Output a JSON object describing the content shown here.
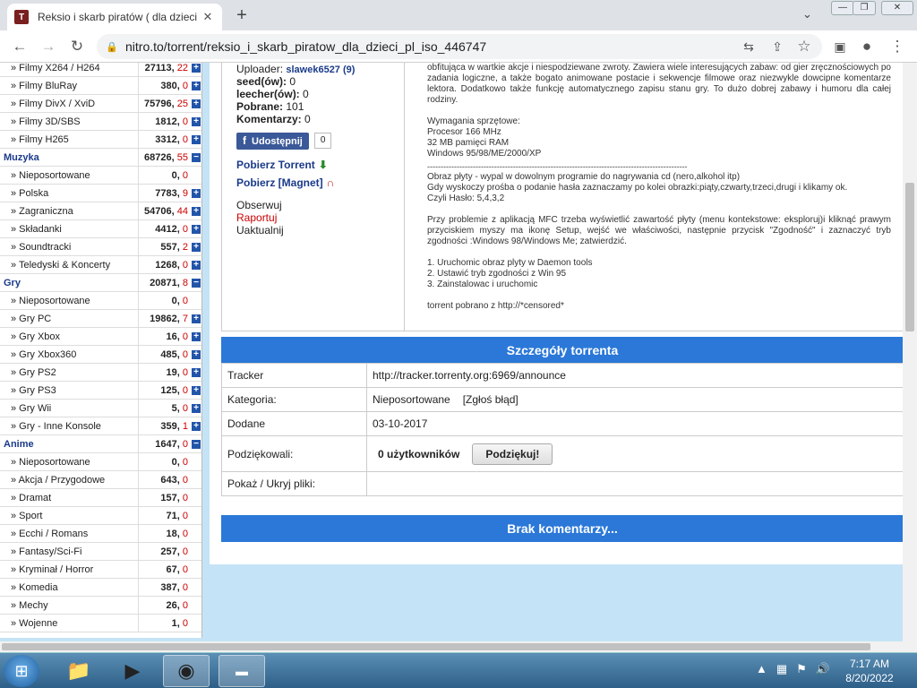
{
  "browser": {
    "tab_title": "Reksio i skarb piratów ( dla dzieci",
    "tab_favicon": "T",
    "url": "nitro.to/torrent/reksio_i_skarb_piratow_dla_dzieci_pl_iso_446747"
  },
  "sidebar": {
    "items": [
      {
        "label": "» Filmy X264 / H264",
        "count": "27113,",
        "new": "22",
        "sub": true,
        "toggle": "+"
      },
      {
        "label": "» Filmy BluRay",
        "count": "380,",
        "new": "0",
        "sub": true,
        "toggle": "+"
      },
      {
        "label": "» Filmy DivX / XviD",
        "count": "75796,",
        "new": "25",
        "sub": true,
        "toggle": "+"
      },
      {
        "label": "» Filmy 3D/SBS",
        "count": "1812,",
        "new": "0",
        "sub": true,
        "toggle": "+"
      },
      {
        "label": "» Filmy H265",
        "count": "3312,",
        "new": "0",
        "sub": true,
        "toggle": "+"
      },
      {
        "label": "Muzyka",
        "count": "68726,",
        "new": "55",
        "sub": false,
        "toggle": "−"
      },
      {
        "label": "» Nieposortowane",
        "count": "0,",
        "new": "0",
        "sub": true,
        "toggle": ""
      },
      {
        "label": "» Polska",
        "count": "7783,",
        "new": "9",
        "sub": true,
        "toggle": "+"
      },
      {
        "label": "» Zagraniczna",
        "count": "54706,",
        "new": "44",
        "sub": true,
        "toggle": "+"
      },
      {
        "label": "» Składanki",
        "count": "4412,",
        "new": "0",
        "sub": true,
        "toggle": "+"
      },
      {
        "label": "» Soundtracki",
        "count": "557,",
        "new": "2",
        "sub": true,
        "toggle": "+"
      },
      {
        "label": "» Teledyski & Koncerty",
        "count": "1268,",
        "new": "0",
        "sub": true,
        "toggle": "+"
      },
      {
        "label": "Gry",
        "count": "20871,",
        "new": "8",
        "sub": false,
        "toggle": "−"
      },
      {
        "label": "» Nieposortowane",
        "count": "0,",
        "new": "0",
        "sub": true,
        "toggle": ""
      },
      {
        "label": "» Gry PC",
        "count": "19862,",
        "new": "7",
        "sub": true,
        "toggle": "+"
      },
      {
        "label": "» Gry Xbox",
        "count": "16,",
        "new": "0",
        "sub": true,
        "toggle": "+"
      },
      {
        "label": "» Gry Xbox360",
        "count": "485,",
        "new": "0",
        "sub": true,
        "toggle": "+"
      },
      {
        "label": "» Gry PS2",
        "count": "19,",
        "new": "0",
        "sub": true,
        "toggle": "+"
      },
      {
        "label": "» Gry PS3",
        "count": "125,",
        "new": "0",
        "sub": true,
        "toggle": "+"
      },
      {
        "label": "» Gry Wii",
        "count": "5,",
        "new": "0",
        "sub": true,
        "toggle": "+"
      },
      {
        "label": "» Gry - Inne Konsole",
        "count": "359,",
        "new": "1",
        "sub": true,
        "toggle": "+"
      },
      {
        "label": "Anime",
        "count": "1647,",
        "new": "0",
        "sub": false,
        "toggle": "−"
      },
      {
        "label": "» Nieposortowane",
        "count": "0,",
        "new": "0",
        "sub": true,
        "toggle": ""
      },
      {
        "label": "» Akcja / Przygodowe",
        "count": "643,",
        "new": "0",
        "sub": true,
        "toggle": ""
      },
      {
        "label": "» Dramat",
        "count": "157,",
        "new": "0",
        "sub": true,
        "toggle": ""
      },
      {
        "label": "» Sport",
        "count": "71,",
        "new": "0",
        "sub": true,
        "toggle": ""
      },
      {
        "label": "» Ecchi / Romans",
        "count": "18,",
        "new": "0",
        "sub": true,
        "toggle": ""
      },
      {
        "label": "» Fantasy/Sci-Fi",
        "count": "257,",
        "new": "0",
        "sub": true,
        "toggle": ""
      },
      {
        "label": "» Kryminał / Horror",
        "count": "67,",
        "new": "0",
        "sub": true,
        "toggle": ""
      },
      {
        "label": "» Komedia",
        "count": "387,",
        "new": "0",
        "sub": true,
        "toggle": ""
      },
      {
        "label": "» Mechy",
        "count": "26,",
        "new": "0",
        "sub": true,
        "toggle": ""
      },
      {
        "label": "» Wojenne",
        "count": "1,",
        "new": "0",
        "sub": true,
        "toggle": ""
      }
    ]
  },
  "info": {
    "uploader_label": "Uploader:",
    "uploader_name": "slawek6527 (9)",
    "seeds_label": "seed(ów):",
    "seeds": "0",
    "leechers_label": "leecher(ów):",
    "leechers": "0",
    "downloads_label": "Pobrane:",
    "downloads": "101",
    "comments_label": "Komentarzy:",
    "comments": "0",
    "share_label": "Udostępnij",
    "share_count": "0",
    "download_torrent": "Pobierz Torrent",
    "download_magnet": "Pobierz [Magnet]",
    "watch": "Obserwuj",
    "report": "Raportuj",
    "update": "Uaktualnij"
  },
  "description": {
    "p1": "obfitująca w wartkie akcje i niespodziewane zwroty. Zawiera wiele interesujących zabaw: od gier zręcznościowych po zadania logiczne, a także bogato animowane postacie i sekwencje filmowe oraz niezwykle dowcipne komentarze lektora. Dodatkowo także funkcję automatycznego zapisu stanu gry. To dużo dobrej zabawy i humoru dla całej rodziny.",
    "req_title": "Wymagania sprzętowe:",
    "req_cpu": "Procesor 166 MHz",
    "req_ram": "32 MB pamięci RAM",
    "req_os": "Windows 95/98/ME/2000/XP",
    "sep": "----------------------------------------------------------------------------------------------------",
    "img1": "Obraz płyty - wypal w dowolnym programie do nagrywania cd (nero,alkohol itp)",
    "img2": "Gdy wyskoczy prośba o podanie hasła zaznaczamy po kolei obrazki:piąty,czwarty,trzeci,drugi i klikamy ok.",
    "img3": "Czyli Hasło: 5,4,3,2",
    "mfc": "Przy problemie z aplikacją MFC trzeba wyświetlić zawartość płyty (menu kontekstowe: eksploruj)i kliknąć prawym przyciskiem myszy ma ikonę Setup, wejść we właściwości, następnie przycisk \"Zgodność\" i zaznaczyć tryb zgodności :Windows 98/Windows Me; zatwierdzić.",
    "step1": "1. Uruchomic obraz plyty w Daemon tools",
    "step2": "2. Ustawić tryb zgodności z Win 95",
    "step3": "3. Zainstalowac i uruchomic",
    "source": "torrent pobrano z http://*censored*"
  },
  "details": {
    "header": "Szczegóły torrenta",
    "tracker_label": "Tracker",
    "tracker": "http://tracker.torrenty.org:6969/announce",
    "category_label": "Kategoria:",
    "category": "Nieposortowane",
    "report_error": "[Zgłoś błąd]",
    "added_label": "Dodane",
    "added": "03-10-2017",
    "thanks_label": "Podziękowali:",
    "thanks_users": "0 użytkowników",
    "thanks_button": "Podziękuj!",
    "files_label": "Pokaż / Ukryj pliki:"
  },
  "comments_header": "Brak komentarzy...",
  "taskbar": {
    "time": "7:17 AM",
    "date": "8/20/2022"
  }
}
